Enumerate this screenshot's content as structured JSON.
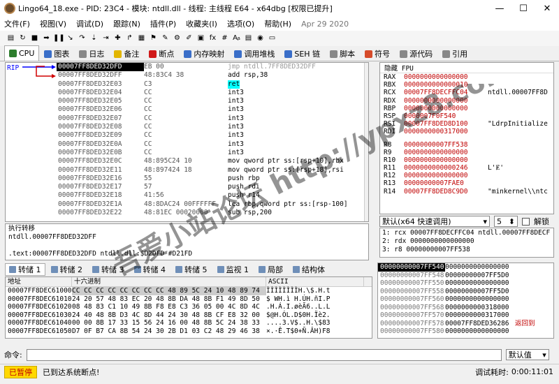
{
  "window": {
    "title": "Lingo64_18.exe - PID: 23C4 - 模块: ntdll.dll - 线程: 主线程 E64 - x64dbg [权限已提升]",
    "minimize": "—",
    "maximize": "☐",
    "close": "✕"
  },
  "menu": {
    "items": [
      "文件(F)",
      "视图(V)",
      "调试(D)",
      "跟踪(N)",
      "插件(P)",
      "收藏夹(I)",
      "选项(O)",
      "帮助(H)"
    ],
    "date": "Apr 29 2020"
  },
  "toolbar": {
    "icons": [
      "▤",
      "↻",
      "■",
      "➡",
      "❚❚",
      "↘",
      "↷",
      "⇣",
      "⇥",
      "✚",
      "↱",
      "▦",
      "⚑",
      "✎",
      "⚙",
      "✐",
      "▣",
      "fx",
      "#",
      "Aᵦ",
      "▤",
      "◉",
      "▭"
    ]
  },
  "tabs": [
    {
      "label": "CPU",
      "color": "#2d7d2d"
    },
    {
      "label": "图表",
      "color": "#3a6ec8"
    },
    {
      "label": "日志",
      "color": "#888888"
    },
    {
      "label": "备注",
      "color": "#e2b600"
    },
    {
      "label": "断点",
      "color": "#d01818"
    },
    {
      "label": "内存映射",
      "color": "#3a6ec8"
    },
    {
      "label": "调用堆栈",
      "color": "#3a6ec8"
    },
    {
      "label": "SEH 链",
      "color": "#3a6ec8"
    },
    {
      "label": "脚本",
      "color": "#888888"
    },
    {
      "label": "符号",
      "color": "#d64b2a"
    },
    {
      "label": "源代码",
      "color": "#888888"
    },
    {
      "label": "引用",
      "color": "#888888"
    }
  ],
  "disasm": {
    "rip_label": "RIP",
    "rows": [
      {
        "addr": "00007FF8DED32DFD",
        "bytes": "EB 00",
        "instr": "jmp ntdll.7FF8DED32DFF"
      },
      {
        "addr": "00007FF8DED32DFF",
        "bytes": "48:83C4 38",
        "instr": "add rsp,38"
      },
      {
        "addr": "00007FF8DED32E03",
        "bytes": "C3",
        "instr": "ret"
      },
      {
        "addr": "00007FF8DED32E04",
        "bytes": "CC",
        "instr": "int3"
      },
      {
        "addr": "00007FF8DED32E05",
        "bytes": "CC",
        "instr": "int3"
      },
      {
        "addr": "00007FF8DED32E06",
        "bytes": "CC",
        "instr": "int3"
      },
      {
        "addr": "00007FF8DED32E07",
        "bytes": "CC",
        "instr": "int3"
      },
      {
        "addr": "00007FF8DED32E08",
        "bytes": "CC",
        "instr": "int3"
      },
      {
        "addr": "00007FF8DED32E09",
        "bytes": "CC",
        "instr": "int3"
      },
      {
        "addr": "00007FF8DED32E0A",
        "bytes": "CC",
        "instr": "int3"
      },
      {
        "addr": "00007FF8DED32E0B",
        "bytes": "CC",
        "instr": "int3"
      },
      {
        "addr": "00007FF8DED32E0C",
        "bytes": "48:895C24 10",
        "instr": "mov qword ptr ss:[rsp+10],rbx"
      },
      {
        "addr": "00007FF8DED32E11",
        "bytes": "48:897424 18",
        "instr": "mov qword ptr ss:[rsp+18],rsi"
      },
      {
        "addr": "00007FF8DED32E16",
        "bytes": "55",
        "instr": "push rbp"
      },
      {
        "addr": "00007FF8DED32E17",
        "bytes": "57",
        "instr": "push rdi"
      },
      {
        "addr": "00007FF8DED32E18",
        "bytes": "41:56",
        "instr": "push r14"
      },
      {
        "addr": "00007FF8DED32E1A",
        "bytes": "48:8DAC24 00FFFFFF",
        "instr": "lea rbp,qword ptr ss:[rsp-100]"
      },
      {
        "addr": "00007FF8DED32E22",
        "bytes": "48:81EC 00020000",
        "instr": "sub rsp,200"
      }
    ]
  },
  "info": {
    "lines": [
      "执行转移",
      "ntdll.00007FF8DED32DFF",
      "",
      ".text:00007FF8DED32DFD ntdll.dll:$D2DFD #D21FD"
    ]
  },
  "registers": {
    "tabs": [
      "隐藏 FPU"
    ],
    "groups": [
      [
        {
          "name": "RAX",
          "value": "0000000000000000",
          "desc": ""
        },
        {
          "name": "RBX",
          "value": "0000000000000010",
          "desc": ""
        },
        {
          "name": "RCX",
          "value": "00007FF8DECFFC04",
          "desc": "ntdll.00007FF8D"
        },
        {
          "name": "RDX",
          "value": "0000000000000000",
          "desc": ""
        },
        {
          "name": "RBP",
          "value": "0000000000000000",
          "desc": ""
        },
        {
          "name": "RSP",
          "value": "0000007F0F540",
          "desc": ""
        },
        {
          "name": "RSI",
          "value": "00007FF8DED8D100",
          "desc": "\"LdrpInitialize"
        },
        {
          "name": "RDI",
          "value": "0000000000317000",
          "desc": ""
        }
      ],
      [
        {
          "name": "R8",
          "value": "00000000007FF538",
          "desc": ""
        },
        {
          "name": "R9",
          "value": "0000000000000000",
          "desc": ""
        },
        {
          "name": "R10",
          "value": "0000000000000000",
          "desc": ""
        },
        {
          "name": "R11",
          "value": "0000000000000246",
          "desc": "L'Ɇ'"
        },
        {
          "name": "R12",
          "value": "0000000000000000",
          "desc": ""
        },
        {
          "name": "R13",
          "value": "00000000007FAE0",
          "desc": ""
        },
        {
          "name": "R14",
          "value": "00007FF8DED8C9D0",
          "desc": "\"minkernel\\\\ntc"
        }
      ]
    ]
  },
  "callconv": {
    "label": "默认(x64 快速调用)",
    "count": "5",
    "unlock": "解锁"
  },
  "args": [
    "1: rcx 00007FF8DECFFC04 ntdll.00007FF8DECF",
    "2: rdx 0000000000000000",
    "3: r8 00000000007FF538"
  ],
  "dumptabs": [
    "转储 1",
    "转储 2",
    "转储 3",
    "转储 4",
    "转储 5",
    "监视 1",
    "局部",
    "结构体"
  ],
  "dump": {
    "headers": [
      "地址",
      "十六进制",
      "ASCII"
    ],
    "rows": [
      {
        "addr": "00007FF8DEC61000",
        "hex": "CC CC CC CC CC CC CC CC 48 89 5C 24 10 48 89 74",
        "ascii": "ÌÌÌÌÌÌÌÌH.\\$.H.t"
      },
      {
        "addr": "00007FF8DEC61010",
        "hex": "24 20 57 48 83 EC 20 48 8B DA 48 8B F1 49 8D 50",
        "ascii": "$ WH.ì H.ÚH.ñI.P"
      },
      {
        "addr": "00007FF8DEC61020",
        "hex": "08 48 83 C1 10 49 8B F8 E8 C3 36 05 00 4C 8D 4C",
        "ascii": ".H.Á.I.øèÃ6..L.L"
      },
      {
        "addr": "00007FF8DEC61030",
        "hex": "24 40 48 8B D3 4C 8D 44 24 30 48 8B CF E8 32 00",
        "ascii": "$@H.ÓL.D$0H.Ïè2."
      },
      {
        "addr": "00007FF8DEC61040",
        "hex": "00 00 8B 17 33 15 56 24 16 00 48 8B 5C 24 38 33",
        "ascii": "....3.V$..H.\\$83"
      },
      {
        "addr": "00007FF8DEC61050",
        "hex": "D7 0F B7 CA 8B 54 24 30 2B D1 03 C2 48 29 46 38",
        "ascii": "×.·Ê.T$0+Ñ.ÂH)F8"
      }
    ]
  },
  "stack": {
    "rows": [
      {
        "addr": "00000000007FF540",
        "val": "0000000000000000",
        "desc": ""
      },
      {
        "addr": "00000000007FF548",
        "val": "00000000007FF5D0",
        "desc": ""
      },
      {
        "addr": "00000000007FF550",
        "val": "0000000000000000",
        "desc": ""
      },
      {
        "addr": "00000000007FF558",
        "val": "00000000007FF5D0",
        "desc": ""
      },
      {
        "addr": "00000000007FF560",
        "val": "0000000000000000",
        "desc": ""
      },
      {
        "addr": "00000000007FF568",
        "val": "0000000000318000",
        "desc": ""
      },
      {
        "addr": "00000000007FF570",
        "val": "0000000000317000",
        "desc": ""
      },
      {
        "addr": "00000000007FF578",
        "val": "00007FF8DED36286",
        "desc": "返回到"
      },
      {
        "addr": "00000000007FF580",
        "val": "0000000000000000",
        "desc": ""
      }
    ]
  },
  "command": {
    "label": "命令:",
    "default": "默认值"
  },
  "status": {
    "state": "已暂停",
    "message": "已到达系统断点!",
    "timer_label": "调试耗时:",
    "timer_value": "0:00:11:01"
  },
  "watermark": {
    "text": "吾爱小站论坛 http://ypxz8.com"
  },
  "colors": {
    "accent_red": "#c00000",
    "paused_bg": "#ffd800",
    "ret_highlight": "#00ffff"
  }
}
